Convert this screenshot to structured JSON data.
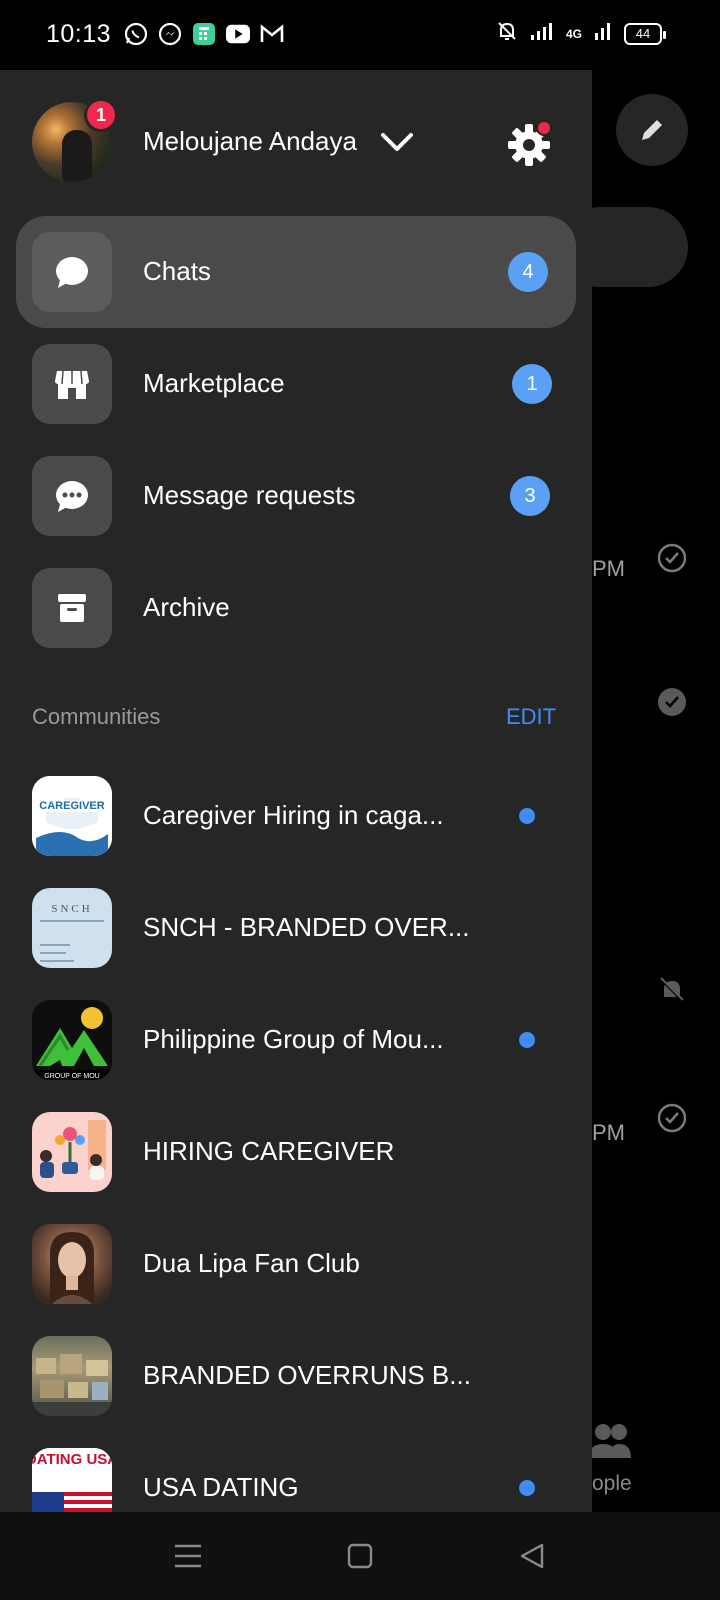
{
  "status_bar": {
    "time": "10:13",
    "app_icons": [
      "whatsapp-icon",
      "messenger-icon",
      "calculator-icon",
      "youtube-icon",
      "gmail-icon"
    ],
    "network_label": "4G",
    "battery": "44"
  },
  "background": {
    "times": [
      "PM",
      "PM"
    ],
    "people_label": "ople"
  },
  "profile": {
    "name": "Meloujane Andaya",
    "notification_count": "1"
  },
  "menu": [
    {
      "label": "Chats",
      "badge": "4",
      "icon": "chat-bubble-icon",
      "active": true
    },
    {
      "label": "Marketplace",
      "badge": "1",
      "icon": "storefront-icon",
      "active": false
    },
    {
      "label": "Message requests",
      "badge": "3",
      "icon": "message-request-icon",
      "active": false
    },
    {
      "label": "Archive",
      "badge": "",
      "icon": "archive-icon",
      "active": false
    }
  ],
  "communities": {
    "title": "Communities",
    "edit_label": "EDIT",
    "items": [
      {
        "label": "Caregiver Hiring in caga...",
        "unread": true,
        "thumb_text": "CAREGIVER"
      },
      {
        "label": "SNCH - BRANDED OVER...",
        "unread": false,
        "thumb_text": "SNCH"
      },
      {
        "label": "Philippine Group of Mou...",
        "unread": true,
        "thumb_text": "GROUP OF MOU"
      },
      {
        "label": "HIRING CAREGIVER",
        "unread": false,
        "thumb_text": ""
      },
      {
        "label": "Dua Lipa Fan Club",
        "unread": false,
        "thumb_text": ""
      },
      {
        "label": "BRANDED OVERRUNS B...",
        "unread": false,
        "thumb_text": ""
      },
      {
        "label": "USA DATING",
        "unread": true,
        "thumb_text": "DATING USA"
      }
    ]
  },
  "colors": {
    "drawer_bg": "#262626",
    "active_bg": "#4a4a4a",
    "badge_blue": "#5aa0f5",
    "accent_blue": "#3d8ef5",
    "notification_red": "#f02849"
  }
}
